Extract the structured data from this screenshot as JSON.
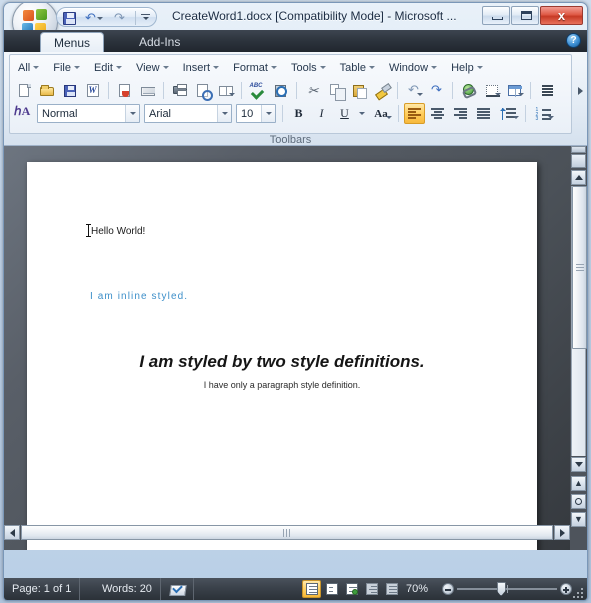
{
  "window": {
    "title": "CreateWord1.docx [Compatibility Mode] - Microsoft ...",
    "orb_name": "office-button",
    "qat": {
      "save_label": "Save",
      "undo_label": "Undo",
      "redo_label": "Redo",
      "customize_label": "Customize Quick Access Toolbar"
    },
    "controls": {
      "minimize": "",
      "maximize": "",
      "close": "x"
    }
  },
  "tabs": [
    {
      "label": "Menus",
      "active": true
    },
    {
      "label": "Add-Ins",
      "active": false
    }
  ],
  "help": {
    "label": "?"
  },
  "menus": [
    {
      "label": "All"
    },
    {
      "label": "File"
    },
    {
      "label": "Edit"
    },
    {
      "label": "View"
    },
    {
      "label": "Insert"
    },
    {
      "label": "Format"
    },
    {
      "label": "Tools"
    },
    {
      "label": "Table"
    },
    {
      "label": "Window"
    },
    {
      "label": "Help"
    }
  ],
  "standard_toolbar": [
    {
      "name": "new-document-icon"
    },
    {
      "name": "open-folder-icon"
    },
    {
      "name": "save-icon"
    },
    {
      "name": "permission-document-icon"
    },
    {
      "name": "email-attachment-icon"
    },
    {
      "name": "envelope-icon"
    },
    {
      "name": "print-icon"
    },
    {
      "name": "print-preview-icon"
    },
    {
      "name": "reading-layout-icon"
    },
    {
      "name": "spelling-grammar-icon"
    },
    {
      "name": "research-icon"
    },
    {
      "name": "cut-icon"
    },
    {
      "name": "copy-icon"
    },
    {
      "name": "paste-icon"
    },
    {
      "name": "format-painter-icon"
    },
    {
      "name": "undo-icon"
    },
    {
      "name": "redo-icon"
    },
    {
      "name": "insert-hyperlink-icon"
    },
    {
      "name": "tables-and-borders-icon"
    },
    {
      "name": "insert-table-icon"
    },
    {
      "name": "columns-icon"
    }
  ],
  "formatting_toolbar": {
    "styles_icon": "styles-and-formatting-icon",
    "style": {
      "value": "Normal",
      "placeholder": "Style"
    },
    "font": {
      "value": "Arial",
      "placeholder": "Font"
    },
    "size": {
      "value": "10",
      "placeholder": "Size"
    },
    "bold_label": "B",
    "italic_label": "I",
    "underline_label": "U",
    "change_case_label": "Aa",
    "align_left_active": true,
    "buttons": [
      {
        "name": "bold-button"
      },
      {
        "name": "italic-button"
      },
      {
        "name": "underline-button"
      },
      {
        "name": "change-case-button"
      },
      {
        "name": "align-left-button"
      },
      {
        "name": "align-center-button"
      },
      {
        "name": "align-right-button"
      },
      {
        "name": "justify-button"
      },
      {
        "name": "line-spacing-button"
      },
      {
        "name": "numbered-list-button"
      }
    ]
  },
  "ribbon_group_label": "Toolbars",
  "document": {
    "paragraphs": [
      {
        "text": "Hello World!",
        "style": "normal"
      },
      {
        "text": "I am inline styled.",
        "style": "inline-styled-blue"
      },
      {
        "text": "I am styled by two style definitions.",
        "style": "bold-italic-heading"
      },
      {
        "text": "I have only a paragraph style definition.",
        "style": "small-centered"
      }
    ]
  },
  "status_bar": {
    "page": "Page: 1 of 1",
    "words": "Words: 20",
    "proofing_icon": "proofing-errors-icon",
    "zoom": "70%",
    "views": [
      {
        "name": "print-layout-view-button",
        "active": true
      },
      {
        "name": "full-screen-reading-view-button",
        "active": false
      },
      {
        "name": "web-layout-view-button",
        "active": false
      },
      {
        "name": "outline-view-button",
        "active": false
      },
      {
        "name": "draft-view-button",
        "active": false
      }
    ],
    "zoom_out_label": "Zoom Out",
    "zoom_in_label": "Zoom In"
  },
  "scrollbars": {
    "vertical": {
      "split_handle": "split-window-handle",
      "browse_object": "select-browse-object-button",
      "previous_page": "previous-page-button",
      "next_page": "next-page-button"
    }
  },
  "colors": {
    "accent_highlight": "#f7b93c",
    "inline_text_blue": "#3d8fc9",
    "titlebar_text": "#1b2c43",
    "tab_active_bg": "#f6f9fc",
    "close_button": "#c63a25",
    "status_bar_bg": "#3a414a"
  }
}
